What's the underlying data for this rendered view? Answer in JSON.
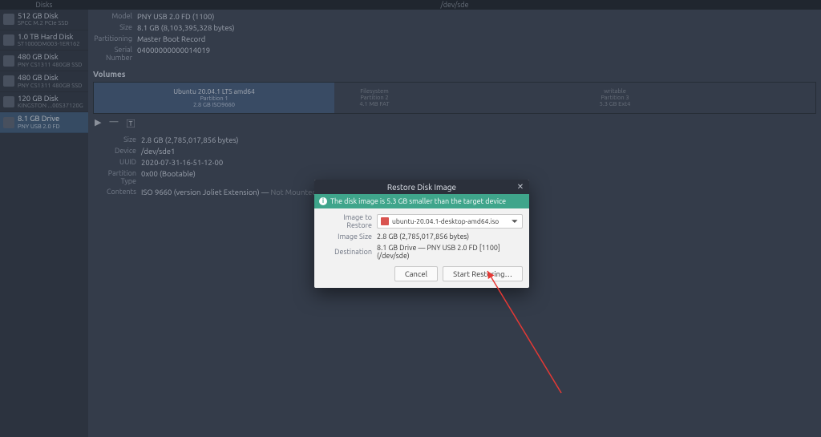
{
  "topbar": {
    "left": "Disks",
    "center": "/dev/sde"
  },
  "sidebar": {
    "items": [
      {
        "name": "512 GB Disk",
        "sub": "SPCC M.2 PCIe SSD"
      },
      {
        "name": "1.0 TB Hard Disk",
        "sub": "ST1000DM003-1ER162"
      },
      {
        "name": "480 GB Disk",
        "sub": "PNY CS1311 480GB SSD"
      },
      {
        "name": "480 GB Disk",
        "sub": "PNY CS1311 480GB SSD"
      },
      {
        "name": "120 GB Disk",
        "sub": "KINGSTON ...00S37120G"
      },
      {
        "name": "8.1 GB Drive",
        "sub": "PNY USB 2.0 FD"
      }
    ],
    "selected_index": 5
  },
  "drive": {
    "model_label": "Model",
    "model": "PNY USB 2.0 FD (1100)",
    "size_label": "Size",
    "size": "8.1 GB (8,103,395,328 bytes)",
    "partitioning_label": "Partitioning",
    "partitioning": "Master Boot Record",
    "serial_label": "Serial Number",
    "serial": "04000000000014019",
    "volumes_label": "Volumes"
  },
  "volumes": {
    "parts": [
      {
        "line1": "Ubuntu 20.04.1 LTS amd64",
        "line2": "Partition 1",
        "line3": "2.8 GB ISO9660"
      },
      {
        "line1": "Filesystem",
        "line2": "Partition 2",
        "line3": "4.1 MB FAT"
      },
      {
        "line1": "writable",
        "line2": "Partition 3",
        "line3": "5.3 GB Ext4"
      }
    ]
  },
  "toolbar_icons": {
    "play": "▶",
    "minus": "—",
    "gear": "🅃"
  },
  "details": {
    "size_label": "Size",
    "size": "2.8 GB (2,785,017,856 bytes)",
    "device_label": "Device",
    "device": "/dev/sde1",
    "uuid_label": "UUID",
    "uuid": "2020-07-31-16-51-12-00",
    "ptype_label": "Partition Type",
    "ptype": "0x00 (Bootable)",
    "contents_label": "Contents",
    "contents_prefix": "ISO 9660 (version Joliet Extension) — ",
    "contents_state": "Not Mounted"
  },
  "dialog": {
    "title": "Restore Disk Image",
    "close_glyph": "✕",
    "info": "The disk image is 5.3 GB smaller than the target device",
    "image_label": "Image to Restore",
    "image_file": "ubuntu-20.04.1-desktop-amd64.iso",
    "image_size_label": "Image Size",
    "image_size": "2.8 GB (2,785,017,856 bytes)",
    "destination_label": "Destination",
    "destination": "8.1 GB Drive — PNY USB 2.0 FD [1100] (/dev/sde)",
    "cancel": "Cancel",
    "start": "Start Restoring…",
    "dropdown_glyph": "⎋"
  },
  "arrow_color": "#e53935"
}
